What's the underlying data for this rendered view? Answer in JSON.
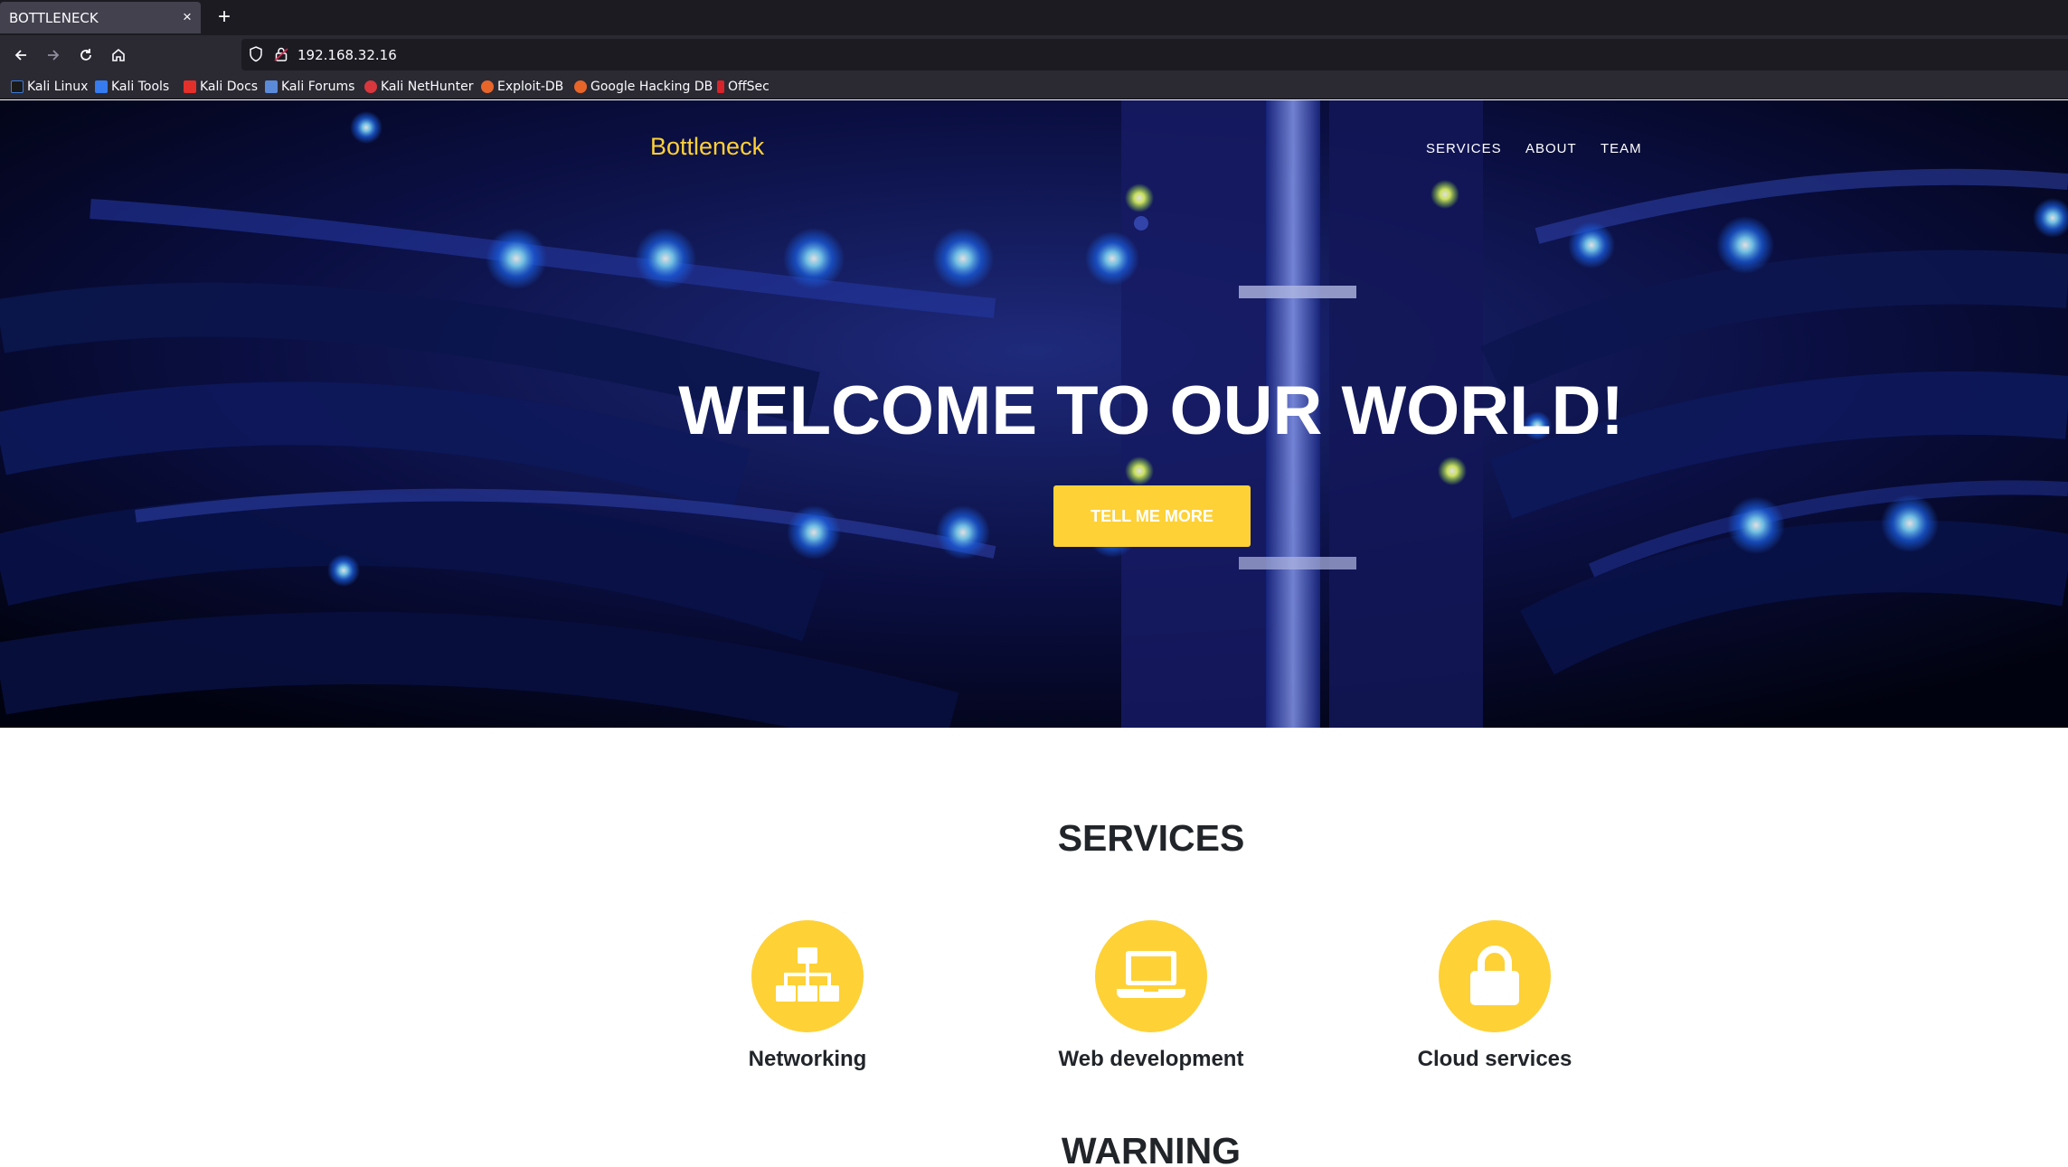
{
  "browser": {
    "tab_title": "BOTTLENECK",
    "tab_close": "×",
    "new_tab": "+",
    "url": "192.168.32.16",
    "bookmarks": [
      {
        "label": "Kali Linux",
        "color": "#3d7bd9"
      },
      {
        "label": "Kali Tools",
        "color": "#367bf0"
      },
      {
        "label": "Kali Docs",
        "color": "#e4302b"
      },
      {
        "label": "Kali Forums",
        "color": "#5b8ad9"
      },
      {
        "label": "Kali NetHunter",
        "color": "#d8373d"
      },
      {
        "label": "Exploit-DB",
        "color": "#e8652a"
      },
      {
        "label": "Google Hacking DB",
        "color": "#e8652a"
      },
      {
        "label": "OffSec",
        "color": "#d8232a"
      }
    ]
  },
  "site": {
    "brand": "Bottleneck",
    "nav": [
      "SERVICES",
      "ABOUT",
      "TEAM"
    ],
    "hero_title": "WELCOME TO OUR WORLD!",
    "hero_button": "TELL ME MORE",
    "services_title": "SERVICES",
    "services": [
      {
        "label": "Networking",
        "icon": "sitemap-icon"
      },
      {
        "label": "Web development",
        "icon": "laptop-icon"
      },
      {
        "label": "Cloud services",
        "icon": "lock-icon"
      }
    ],
    "warning_title": "WARNING",
    "colors": {
      "accent": "#fed136",
      "text_dark": "#212529"
    }
  }
}
